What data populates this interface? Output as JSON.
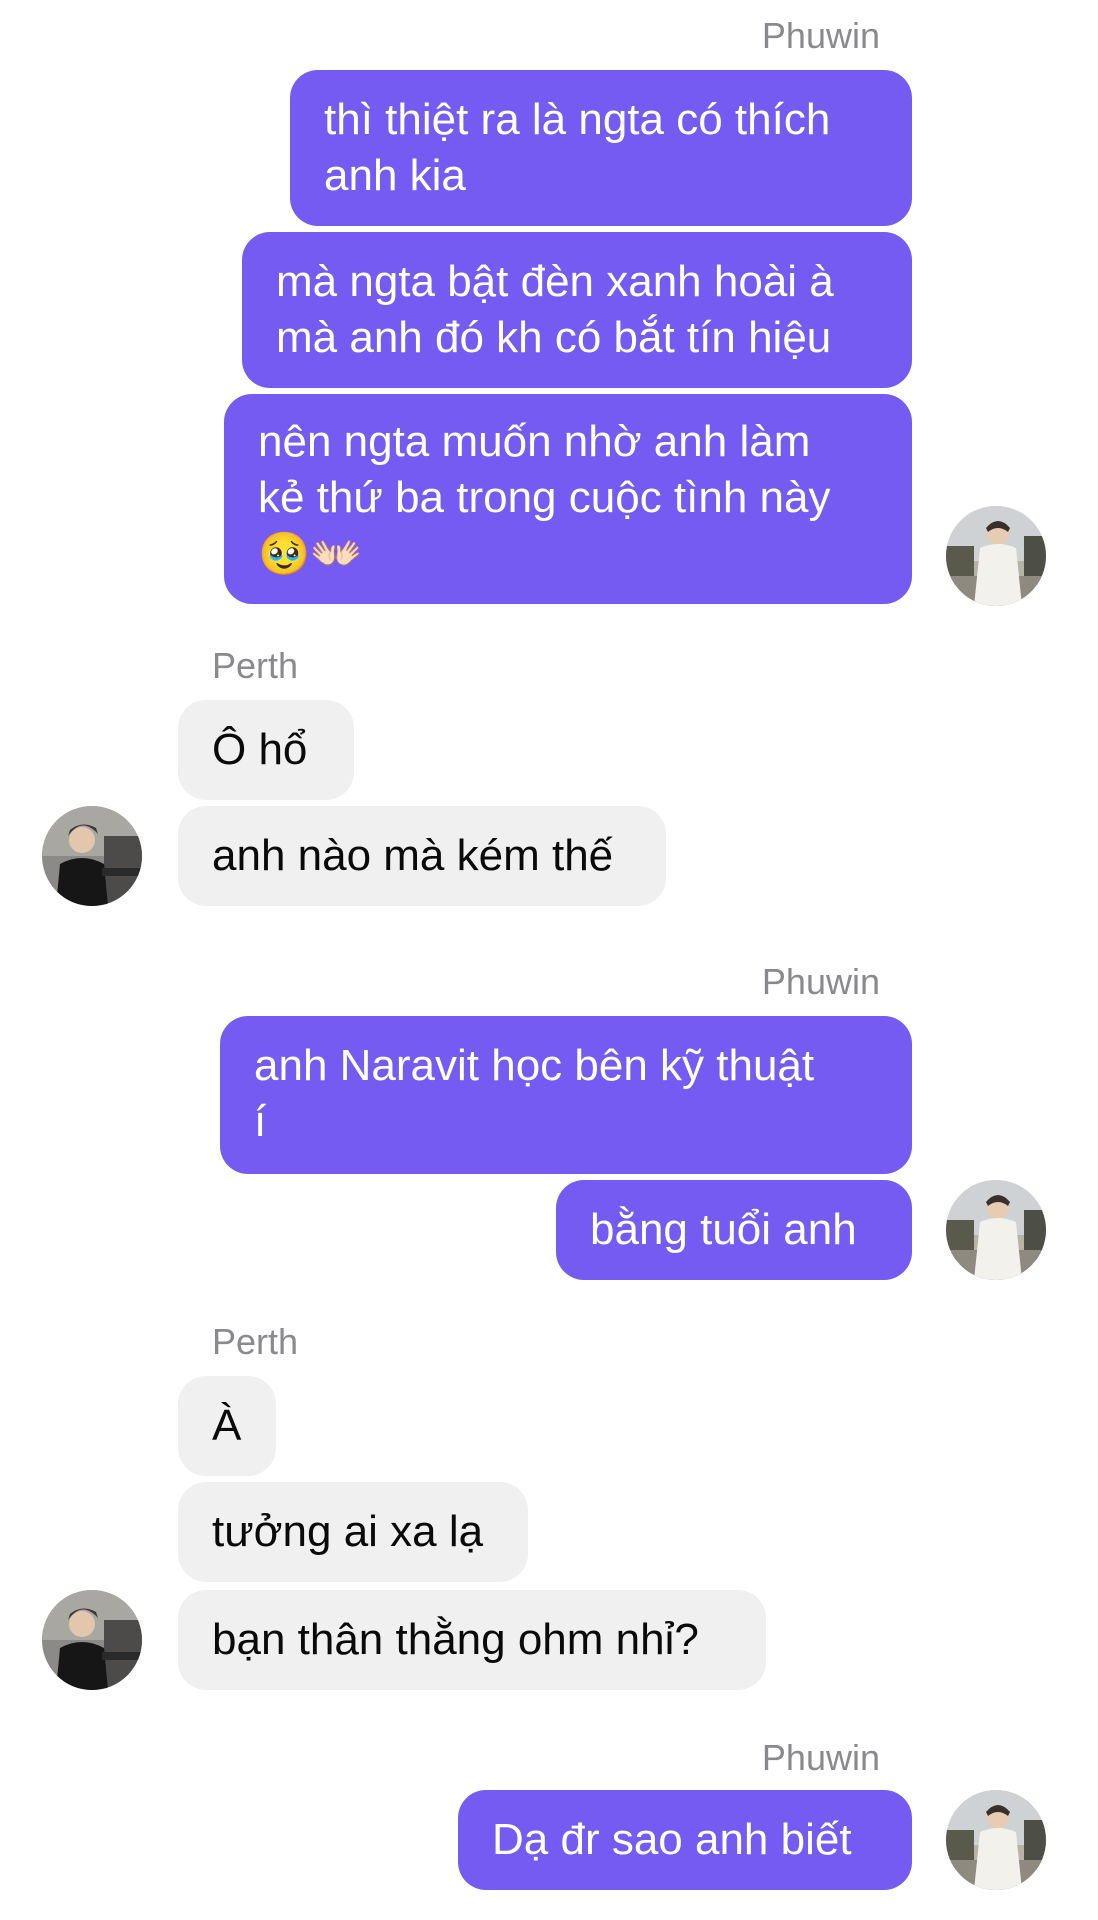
{
  "chat": {
    "messages": [
      {
        "sender": "Phuwin",
        "lines": [
          "thì thiệt ra là ngta có thích",
          "anh kia"
        ]
      },
      {
        "sender": "Phuwin",
        "lines": [
          "mà ngta bật đèn xanh hoài à",
          "mà anh đó kh có bắt tín hiệu"
        ]
      },
      {
        "sender": "Phuwin",
        "lines": [
          "nên ngta muốn nhờ anh làm",
          "kẻ thứ ba trong cuộc tình này",
          "🥹👐🏻"
        ]
      },
      {
        "sender": "Perth",
        "lines": [
          "Ô hổ"
        ]
      },
      {
        "sender": "Perth",
        "lines": [
          "anh nào mà kém thế"
        ]
      },
      {
        "sender": "Phuwin",
        "lines": [
          "anh Naravit học bên kỹ thuật",
          "í"
        ]
      },
      {
        "sender": "Phuwin",
        "lines": [
          "bằng tuổi anh"
        ]
      },
      {
        "sender": "Perth",
        "lines": [
          "À"
        ]
      },
      {
        "sender": "Perth",
        "lines": [
          "tưởng ai xa lạ"
        ]
      },
      {
        "sender": "Perth",
        "lines": [
          "bạn thân thằng ohm nhỉ?"
        ]
      },
      {
        "sender": "Phuwin",
        "lines": [
          "Dạ đr sao anh biết"
        ]
      }
    ],
    "sender_labels": [
      "Phuwin",
      "Perth",
      "Phuwin",
      "Perth",
      "Phuwin"
    ],
    "colors": {
      "outgoing_bubble": "#755bf2",
      "incoming_bubble": "#f0f0f1",
      "sender_label": "#8a8a8e"
    },
    "avatars": {
      "phuwin": "avatar-phuwin",
      "perth": "avatar-perth"
    }
  }
}
